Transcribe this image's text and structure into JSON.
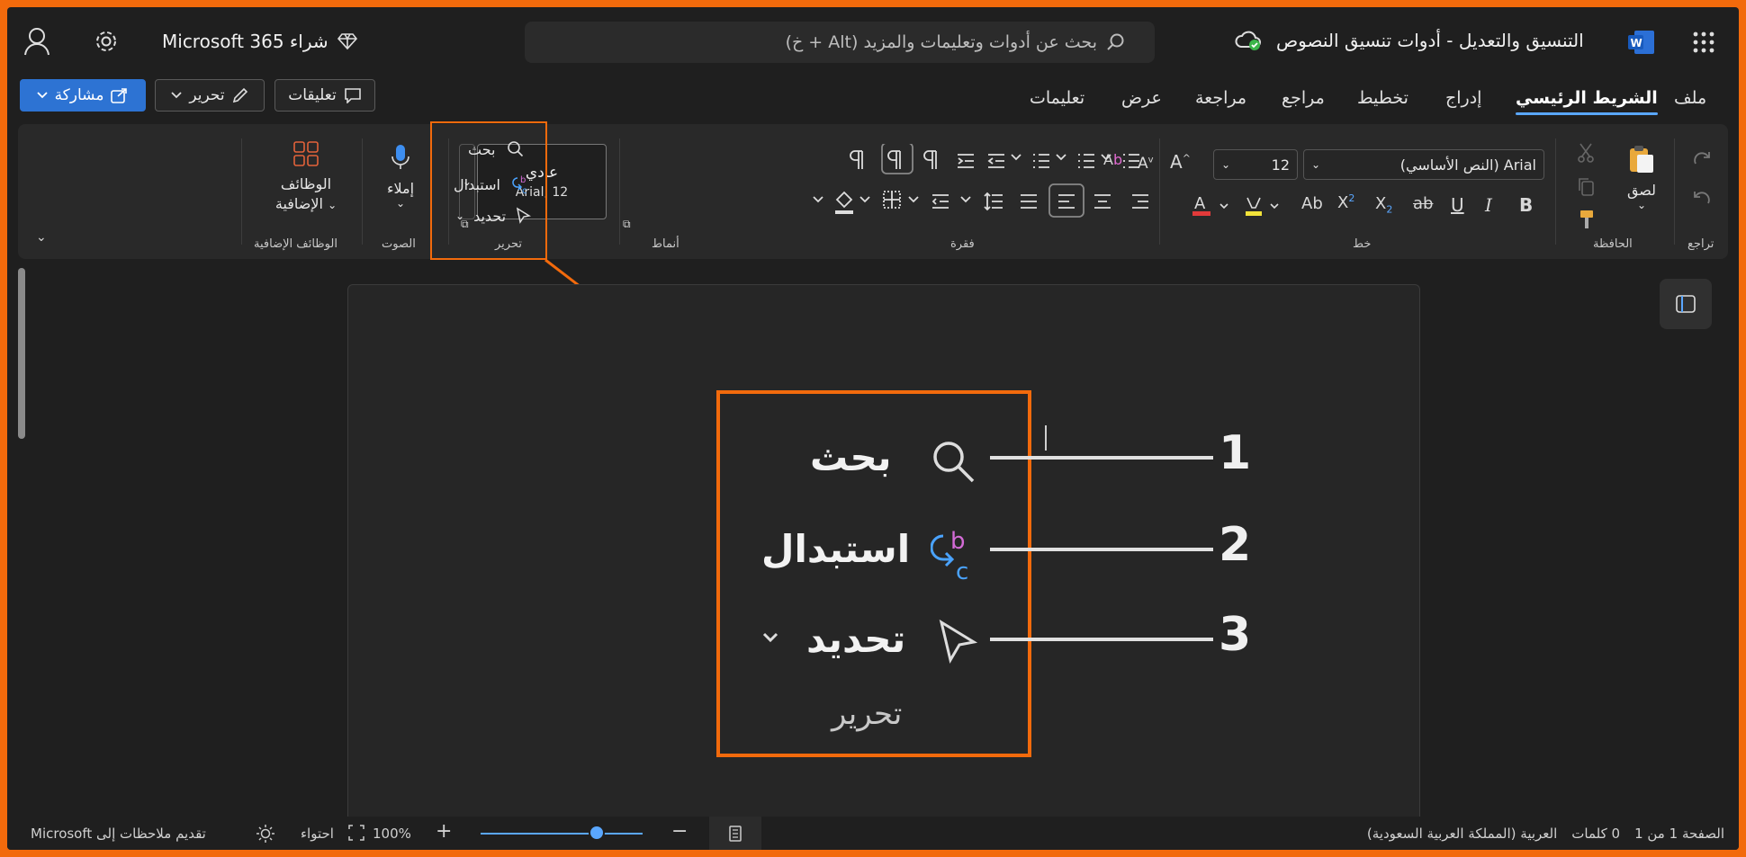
{
  "titlebar": {
    "doc_title": "التنسيق والتعديل - أدوات تنسيق النصوص",
    "buy_label": "شراء Microsoft 365",
    "search_placeholder": "بحث عن أدوات وتعليمات والمزيد (Alt + خ)"
  },
  "actions": {
    "comments": "تعليقات",
    "editing": "تحرير",
    "share": "مشاركة"
  },
  "tabs": [
    "ملف",
    "الشريط الرئيسي",
    "إدراج",
    "تخطيط",
    "مراجع",
    "مراجعة",
    "عرض",
    "تعليمات"
  ],
  "ribbon": {
    "groups": {
      "undo": "تراجع",
      "clipboard": "الحافظة",
      "font": "خط",
      "paragraph": "فقرة",
      "styles": "أنماط",
      "editing": "تحرير",
      "voice": "الصوت",
      "addins": "الوظائف الإضافية"
    },
    "paste_label": "لصق",
    "font_name": "Arial (النص الأساسي)",
    "font_size": "12",
    "style_name": "عادي",
    "style_font": "Arial, 12",
    "find": "بحث",
    "replace": "استبدال",
    "select": "تحديد",
    "dictate": "إملاء",
    "addins_line1": "الوظائف",
    "addins_line2": "الإضافية"
  },
  "callout": {
    "items": [
      {
        "num": "1",
        "label": "بحث"
      },
      {
        "num": "2",
        "label": "استبدال"
      },
      {
        "num": "3",
        "label": "تحديد"
      }
    ],
    "group_label": "تحرير"
  },
  "status": {
    "page": "الصفحة 1 من 1",
    "words": "0 كلمات",
    "language": "العربية (المملكة العربية السعودية)",
    "zoom": "100%",
    "fit": "احتواء",
    "feedback": "تقديم ملاحظات إلى Microsoft"
  },
  "colors": {
    "accent": "#f26a0c",
    "share_blue": "#2d73d3",
    "word_blue": "#2b6fd6"
  }
}
